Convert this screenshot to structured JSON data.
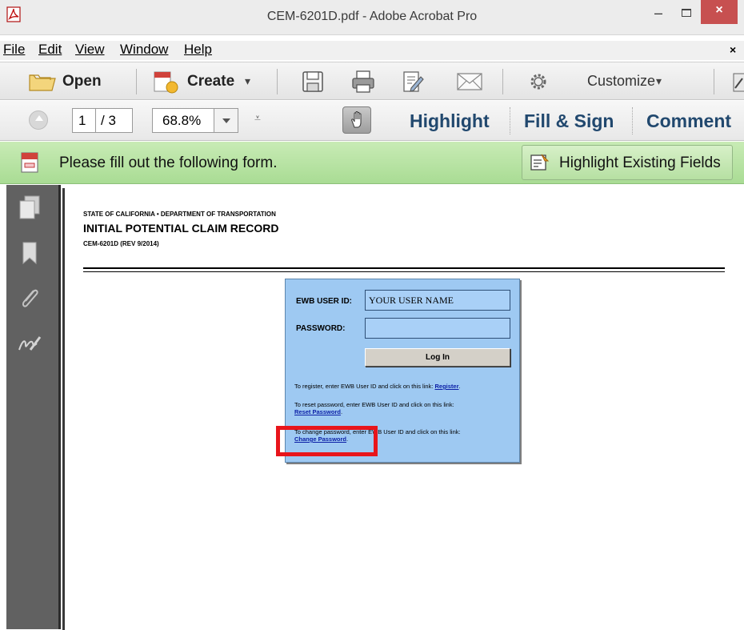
{
  "window": {
    "title": "CEM-6201D.pdf - Adobe Acrobat Pro",
    "min_label": "–",
    "close_label": "×"
  },
  "menu": {
    "items": [
      {
        "label": "File",
        "key": "F"
      },
      {
        "label": "Edit",
        "key": "E"
      },
      {
        "label": "View",
        "key": "V"
      },
      {
        "label": "Window",
        "key": "W"
      },
      {
        "label": "Help",
        "key": "H"
      }
    ],
    "close_label": "×"
  },
  "toolbar": {
    "open_label": "Open",
    "create_label": "Create",
    "create_arrow": "▾",
    "customize_label": "Customize",
    "customize_arrow": "▾"
  },
  "navbar": {
    "page_current": "1",
    "page_total": "/ 3",
    "zoom": "68.8%",
    "more_symbol": "⩡",
    "highlight_label": "Highlight",
    "fill_sign_label": "Fill & Sign",
    "comment_label": "Comment"
  },
  "formbar": {
    "message": "Please fill out the following form.",
    "highlight_fields_label": "Highlight Existing Fields"
  },
  "document": {
    "header_line1": "STATE OF CALIFORNIA • DEPARTMENT OF TRANSPORTATION",
    "header_title": "INITIAL POTENTIAL CLAIM RECORD",
    "header_code": "CEM-6201D (REV 9/2014)"
  },
  "login": {
    "user_label": "EWB USER ID:",
    "user_value": "YOUR USER NAME",
    "password_label": "PASSWORD:",
    "password_value": "",
    "login_button": "Log In",
    "register_text": "To register, enter EWB User ID and click on this link:",
    "register_link": "Register",
    "reset_text": "To reset password, enter EWB User ID and click on this link:",
    "reset_link": "Reset Password",
    "change_text": "To change password, enter EWB User ID and click on this link:",
    "change_link": "Change Password",
    "period": "."
  }
}
